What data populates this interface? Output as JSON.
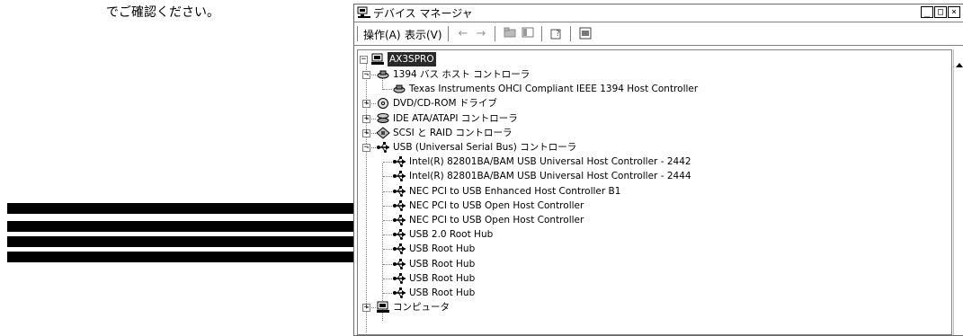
{
  "caption": "でご確認ください。",
  "window": {
    "title": "デバイス マネージャ",
    "controls": {
      "minimize": "_",
      "maximize": "□",
      "close": "×"
    }
  },
  "menu": {
    "action": "操作(A)",
    "view": "表示(V)"
  },
  "toolbar": {
    "back": "←",
    "forward": "→"
  },
  "tree": {
    "root": "AX3SPRO",
    "nodes": [
      {
        "label": "1394 バス ホスト コントローラ",
        "icon": "ieee1394-icon"
      },
      {
        "label": "Texas Instruments OHCI Compliant IEEE 1394 Host Controller",
        "icon": "ieee1394-icon"
      },
      {
        "label": "DVD/CD-ROM ドライブ",
        "icon": "cdrom-icon"
      },
      {
        "label": "IDE ATA/ATAPI コントローラ",
        "icon": "ide-controller-icon"
      },
      {
        "label": "SCSI と RAID コントローラ",
        "icon": "scsi-icon"
      },
      {
        "label": "USB (Universal Serial Bus) コントローラ",
        "icon": "usb-icon"
      },
      {
        "label": "Intel(R) 82801BA/BAM USB Universal Host Controller - 2442",
        "icon": "usb-icon"
      },
      {
        "label": "Intel(R) 82801BA/BAM USB Universal Host Controller - 2444",
        "icon": "usb-icon"
      },
      {
        "label": "NEC PCI to USB Enhanced Host Controller B1",
        "icon": "usb-icon"
      },
      {
        "label": "NEC PCI to USB Open Host Controller",
        "icon": "usb-icon"
      },
      {
        "label": "NEC PCI to USB Open Host Controller",
        "icon": "usb-icon"
      },
      {
        "label": "USB 2.0 Root Hub",
        "icon": "usb-icon"
      },
      {
        "label": "USB Root Hub",
        "icon": "usb-icon"
      },
      {
        "label": "USB Root Hub",
        "icon": "usb-icon"
      },
      {
        "label": "USB Root Hub",
        "icon": "usb-icon"
      },
      {
        "label": "USB Root Hub",
        "icon": "usb-icon"
      },
      {
        "label": "コンピュータ",
        "icon": "computer-icon"
      }
    ]
  },
  "colors": {
    "arrow": "#000000",
    "selection": "#2a2a2a"
  }
}
